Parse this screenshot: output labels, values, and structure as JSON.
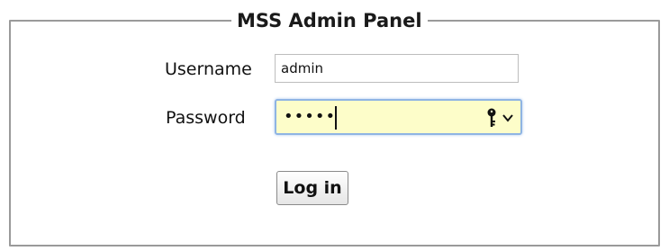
{
  "panel": {
    "title": "MSS Admin Panel"
  },
  "form": {
    "username_label": "Username",
    "username_value": "admin",
    "password_label": "Password",
    "password_masked": "•••••",
    "login_label": "Log in"
  },
  "colors": {
    "panel_border": "#9a9a9a",
    "password_field_bg": "#fdfdc9",
    "password_field_focus": "#8fb4e3"
  },
  "icons": [
    "key-icon",
    "chevron-down-icon"
  ]
}
